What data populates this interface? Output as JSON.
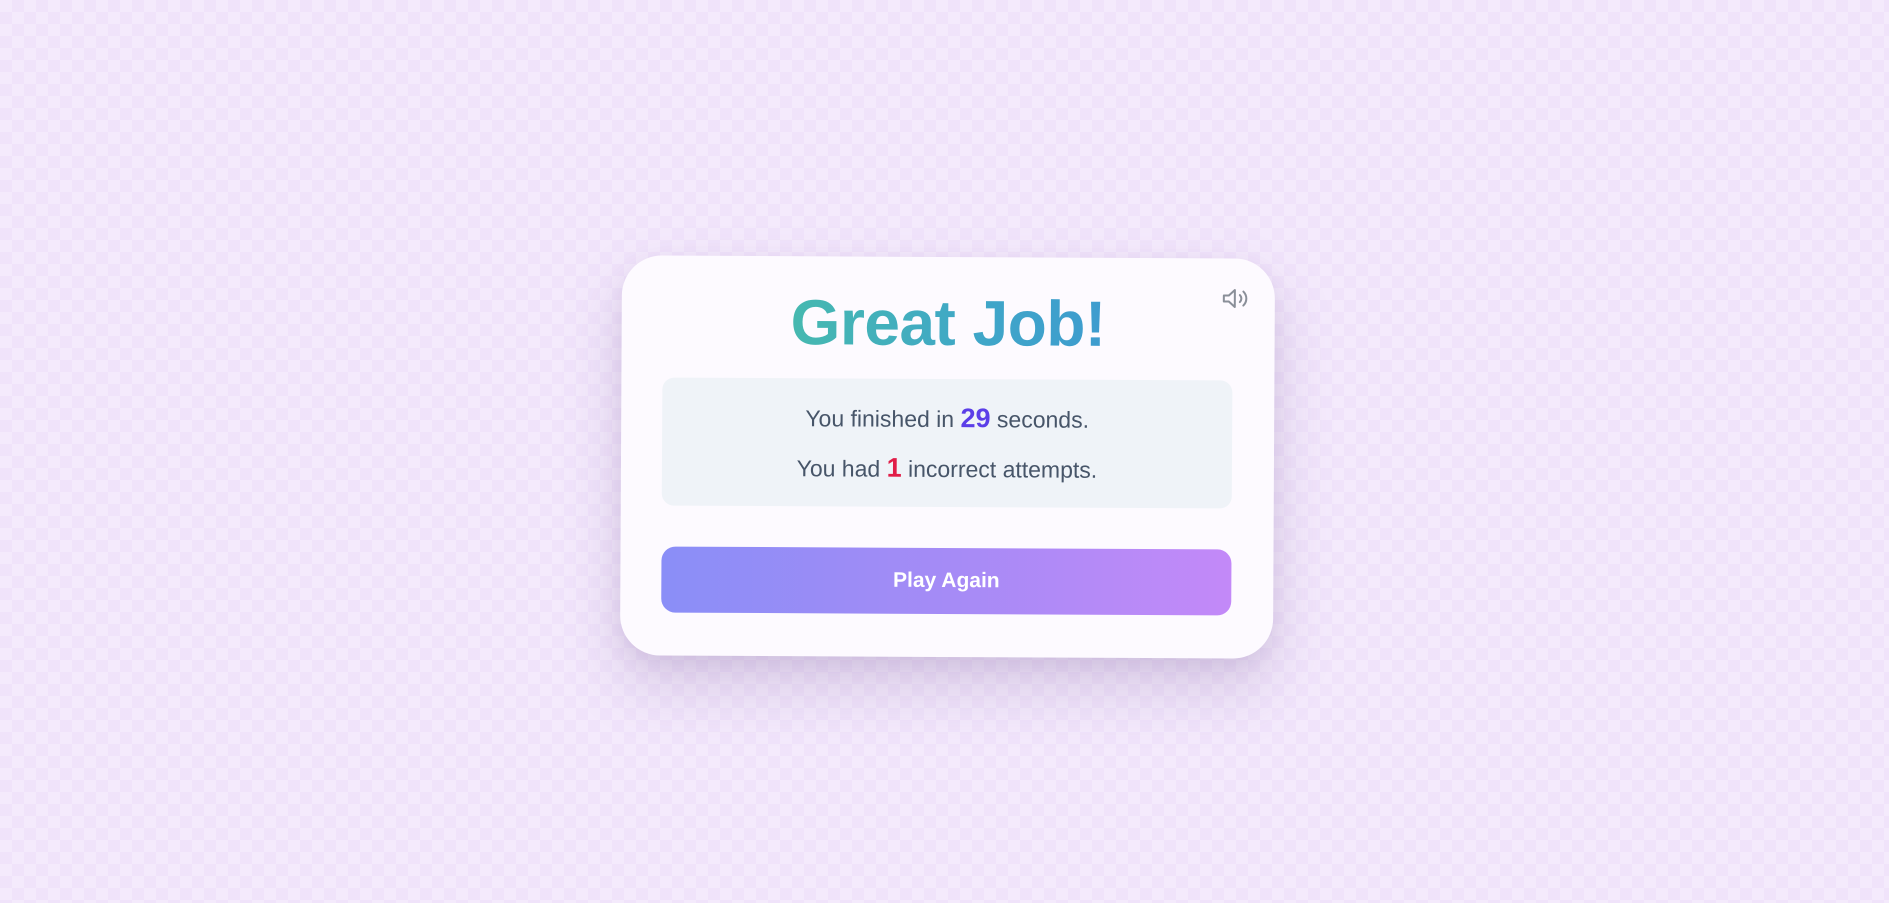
{
  "card": {
    "title": "Great Job!",
    "sound_icon": "speaker-volume-icon",
    "stats": {
      "time_prefix": "You finished in",
      "time_value": "29",
      "time_suffix": "seconds.",
      "errors_prefix": "You had",
      "errors_value": "1",
      "errors_suffix": "incorrect attempts."
    },
    "play_again_label": "Play Again"
  },
  "colors": {
    "background": "#f4eafc",
    "card": "#fdfaff",
    "title_gradient": [
      "#4cc99a",
      "#3d8ed8"
    ],
    "time_value": "#5b3ee8",
    "errors_value": "#e11d48",
    "button_gradient": [
      "#8a8ef7",
      "#c389f8"
    ]
  }
}
